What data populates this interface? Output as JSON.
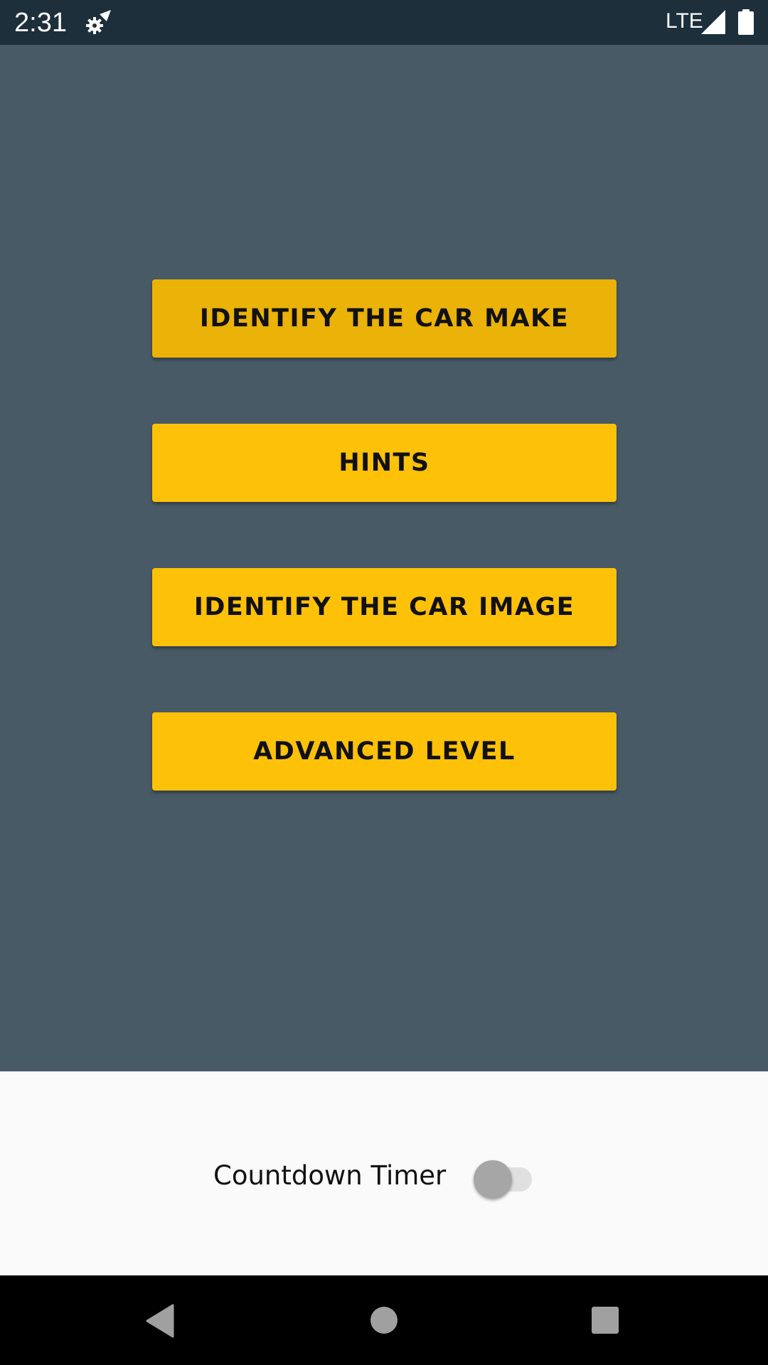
{
  "status_bar": {
    "time": "2:31",
    "network": "LTE",
    "icons": [
      "settings-icon",
      "signal-icon",
      "battery-icon"
    ],
    "background_color": "#1c2f3b"
  },
  "main": {
    "background_color": "#475a66",
    "button_color": "#fdc108",
    "buttons": [
      {
        "label": "IDENTIFY THE CAR MAKE",
        "state": "pressed"
      },
      {
        "label": "HINTS",
        "state": "normal"
      },
      {
        "label": "IDENTIFY THE CAR IMAGE",
        "state": "normal"
      },
      {
        "label": "ADVANCED LEVEL",
        "state": "normal"
      }
    ]
  },
  "settings": {
    "countdown_timer_label": "Countdown Timer",
    "countdown_timer_enabled": false
  },
  "nav_bar": {
    "icons": [
      "back-icon",
      "home-icon",
      "recents-icon"
    ]
  }
}
